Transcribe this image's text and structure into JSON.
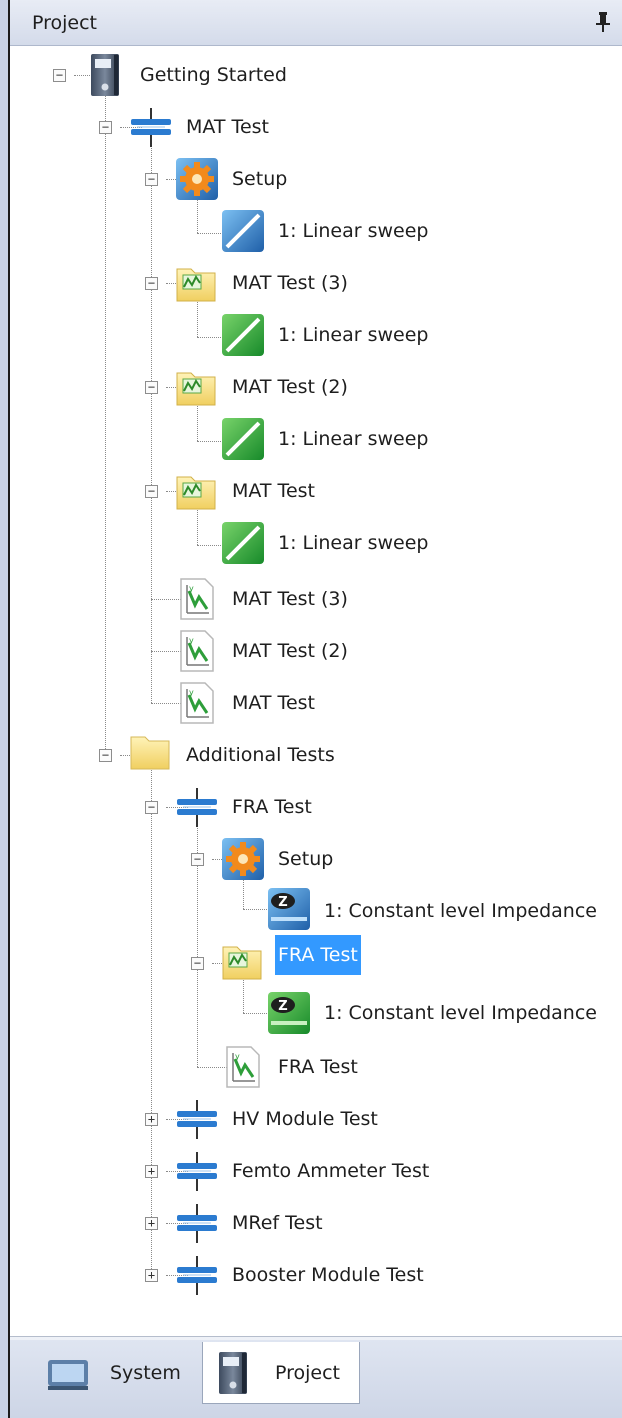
{
  "panel": {
    "title": "Project",
    "pin_icon": "pin-icon"
  },
  "tree": {
    "getting_started": "Getting Started",
    "mat_test": "MAT Test",
    "mat_setup": "Setup",
    "mat_setup_sweep": "1: Linear sweep",
    "mat_test_3": "MAT Test (3)",
    "mat_test_3_sweep": "1: Linear sweep",
    "mat_test_2": "MAT Test (2)",
    "mat_test_2_sweep": "1: Linear sweep",
    "mat_test_1": "MAT Test",
    "mat_test_1_sweep": "1: Linear sweep",
    "mat_graph_3": "MAT Test (3)",
    "mat_graph_2": "MAT Test (2)",
    "mat_graph_1": "MAT Test",
    "additional_tests": "Additional Tests",
    "fra_test": "FRA Test",
    "fra_setup": "Setup",
    "fra_setup_impedance": "1: Constant level Impedance",
    "fra_result": "FRA Test",
    "fra_result_impedance": "1: Constant level Impedance",
    "fra_graph": "FRA Test",
    "hv_module_test": "HV Module Test",
    "femto_ammeter_test": "Femto Ammeter Test",
    "mref_test": "MRef Test",
    "booster_module_test": "Booster Module Test"
  },
  "tabs": {
    "system": "System",
    "project": "Project",
    "active": "Project"
  },
  "colors": {
    "selection": "#3399ff",
    "accent_blue": "#2b7bd0",
    "sweep_green": "#2ea23a"
  }
}
